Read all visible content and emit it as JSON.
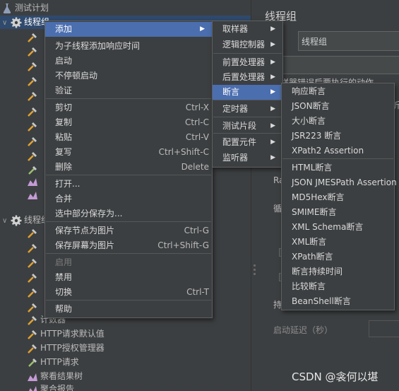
{
  "tree": {
    "root": "测试计划",
    "group1": "线程组",
    "group2": "线程组",
    "tail": [
      "计数器",
      "HTTP请求默认值",
      "HTTP授权管理器",
      "HTTP请求",
      "察看结果树",
      "聚合报告"
    ]
  },
  "right_panel": {
    "title": "线程组",
    "name_label": "：",
    "name_value": "线程组",
    "error_action": "样器错误后要执行的动作",
    "error_action_tail": "沂",
    "ra": "Ra",
    "loop": "循",
    "lasting": "持",
    "startup_delay": "启动延迟（秒）"
  },
  "context_menu": {
    "items": [
      {
        "label": "添加",
        "shortcut": "",
        "submenu": true,
        "highlighted": true,
        "disabled": false
      },
      {
        "label": "为子线程添加响应时间",
        "shortcut": "",
        "submenu": false,
        "highlighted": false,
        "disabled": false
      },
      {
        "label": "启动",
        "shortcut": "",
        "submenu": false,
        "highlighted": false,
        "disabled": false
      },
      {
        "label": "不停顿启动",
        "shortcut": "",
        "submenu": false,
        "highlighted": false,
        "disabled": false
      },
      {
        "label": "验证",
        "shortcut": "",
        "submenu": false,
        "highlighted": false,
        "disabled": false
      },
      {
        "label": "剪切",
        "shortcut": "Ctrl-X",
        "submenu": false,
        "highlighted": false,
        "disabled": false
      },
      {
        "label": "复制",
        "shortcut": "Ctrl-C",
        "submenu": false,
        "highlighted": false,
        "disabled": false
      },
      {
        "label": "粘贴",
        "shortcut": "Ctrl-V",
        "submenu": false,
        "highlighted": false,
        "disabled": false
      },
      {
        "label": "复写",
        "shortcut": "Ctrl+Shift-C",
        "submenu": false,
        "highlighted": false,
        "disabled": false
      },
      {
        "label": "删除",
        "shortcut": "Delete",
        "submenu": false,
        "highlighted": false,
        "disabled": false
      },
      {
        "label": "打开...",
        "shortcut": "",
        "submenu": false,
        "highlighted": false,
        "disabled": false
      },
      {
        "label": "合并",
        "shortcut": "",
        "submenu": false,
        "highlighted": false,
        "disabled": false
      },
      {
        "label": "选中部分保存为...",
        "shortcut": "",
        "submenu": false,
        "highlighted": false,
        "disabled": false
      },
      {
        "label": "保存节点为图片",
        "shortcut": "Ctrl-G",
        "submenu": false,
        "highlighted": false,
        "disabled": false
      },
      {
        "label": "保存屏幕为图片",
        "shortcut": "Ctrl+Shift-G",
        "submenu": false,
        "highlighted": false,
        "disabled": false
      },
      {
        "label": "启用",
        "shortcut": "",
        "submenu": false,
        "highlighted": false,
        "disabled": true
      },
      {
        "label": "禁用",
        "shortcut": "",
        "submenu": false,
        "highlighted": false,
        "disabled": false
      },
      {
        "label": "切换",
        "shortcut": "Ctrl-T",
        "submenu": false,
        "highlighted": false,
        "disabled": false
      },
      {
        "label": "帮助",
        "shortcut": "",
        "submenu": false,
        "highlighted": false,
        "disabled": false
      }
    ]
  },
  "add_submenu": {
    "items": [
      {
        "label": "取样器",
        "highlighted": false
      },
      {
        "label": "逻辑控制器",
        "highlighted": false
      },
      {
        "label": "前置处理器",
        "highlighted": false
      },
      {
        "label": "后置处理器",
        "highlighted": false
      },
      {
        "label": "断言",
        "highlighted": true
      },
      {
        "label": "定时器",
        "highlighted": false
      },
      {
        "label": "测试片段",
        "highlighted": false
      },
      {
        "label": "配置元件",
        "highlighted": false
      },
      {
        "label": "监听器",
        "highlighted": false
      }
    ]
  },
  "assert_submenu": {
    "items": [
      "响应断言",
      "JSON断言",
      "大小断言",
      "JSR223 断言",
      "XPath2 Assertion",
      "HTML断言",
      "JSON JMESPath Assertion",
      "MD5Hex断言",
      "SMIME断言",
      "XML Schema断言",
      "XML断言",
      "XPath断言",
      "断言持续时间",
      "比较断言",
      "BeanShell断言"
    ]
  },
  "watermark": "CSDN @衾何以堪",
  "colors": {
    "background": "#3c3f41",
    "highlight": "#4b6eaf",
    "tree_selection": "#2f4a6d",
    "text": "#bbbbbb"
  }
}
